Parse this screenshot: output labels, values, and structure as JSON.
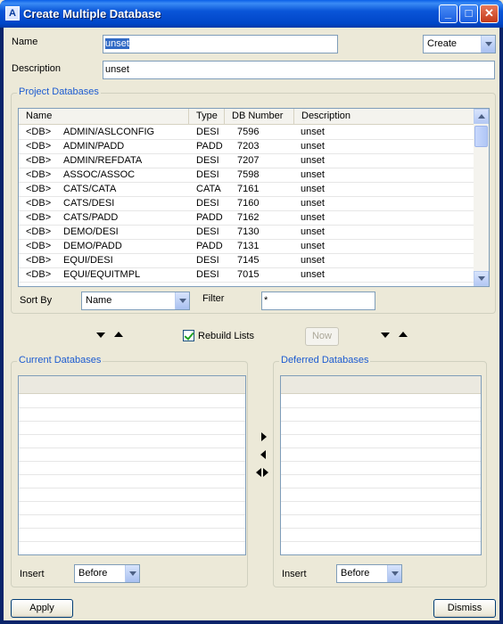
{
  "window": {
    "title": "Create Multiple Database",
    "minimize": "_",
    "maximize": "□",
    "close": "✕"
  },
  "form": {
    "name_label": "Name",
    "name_value": "unset",
    "mode_value": "Create",
    "description_label": "Description",
    "description_value": "unset"
  },
  "project": {
    "group_title": "Project Databases",
    "columns": [
      "Name",
      "Type",
      "DB Number",
      "Description"
    ],
    "rows": [
      [
        "<DB>",
        "ADMIN/ASLCONFIG",
        "DESI",
        "7596",
        "unset"
      ],
      [
        "<DB>",
        "ADMIN/PADD",
        "PADD",
        "7203",
        "unset"
      ],
      [
        "<DB>",
        "ADMIN/REFDATA",
        "DESI",
        "7207",
        "unset"
      ],
      [
        "<DB>",
        "ASSOC/ASSOC",
        "DESI",
        "7598",
        "unset"
      ],
      [
        "<DB>",
        "CATS/CATA",
        "CATA",
        "7161",
        "unset"
      ],
      [
        "<DB>",
        "CATS/DESI",
        "DESI",
        "7160",
        "unset"
      ],
      [
        "<DB>",
        "CATS/PADD",
        "PADD",
        "7162",
        "unset"
      ],
      [
        "<DB>",
        "DEMO/DESI",
        "DESI",
        "7130",
        "unset"
      ],
      [
        "<DB>",
        "DEMO/PADD",
        "PADD",
        "7131",
        "unset"
      ],
      [
        "<DB>",
        "EQUI/DESI",
        "DESI",
        "7145",
        "unset"
      ],
      [
        "<DB>",
        "EQUI/EQUITMPL",
        "DESI",
        "7015",
        "unset"
      ]
    ],
    "sort_label": "Sort By",
    "sort_value": "Name",
    "filter_label": "Filter",
    "filter_value": "*"
  },
  "middle": {
    "rebuild_label": "Rebuild Lists",
    "rebuild_checked": true,
    "now_label": "Now"
  },
  "current": {
    "group_title": "Current Databases",
    "insert_label": "Insert",
    "insert_value": "Before"
  },
  "deferred": {
    "group_title": "Deferred Databases",
    "insert_label": "Insert",
    "insert_value": "Before"
  },
  "footer": {
    "apply_label": "Apply",
    "dismiss_label": "Dismiss"
  }
}
